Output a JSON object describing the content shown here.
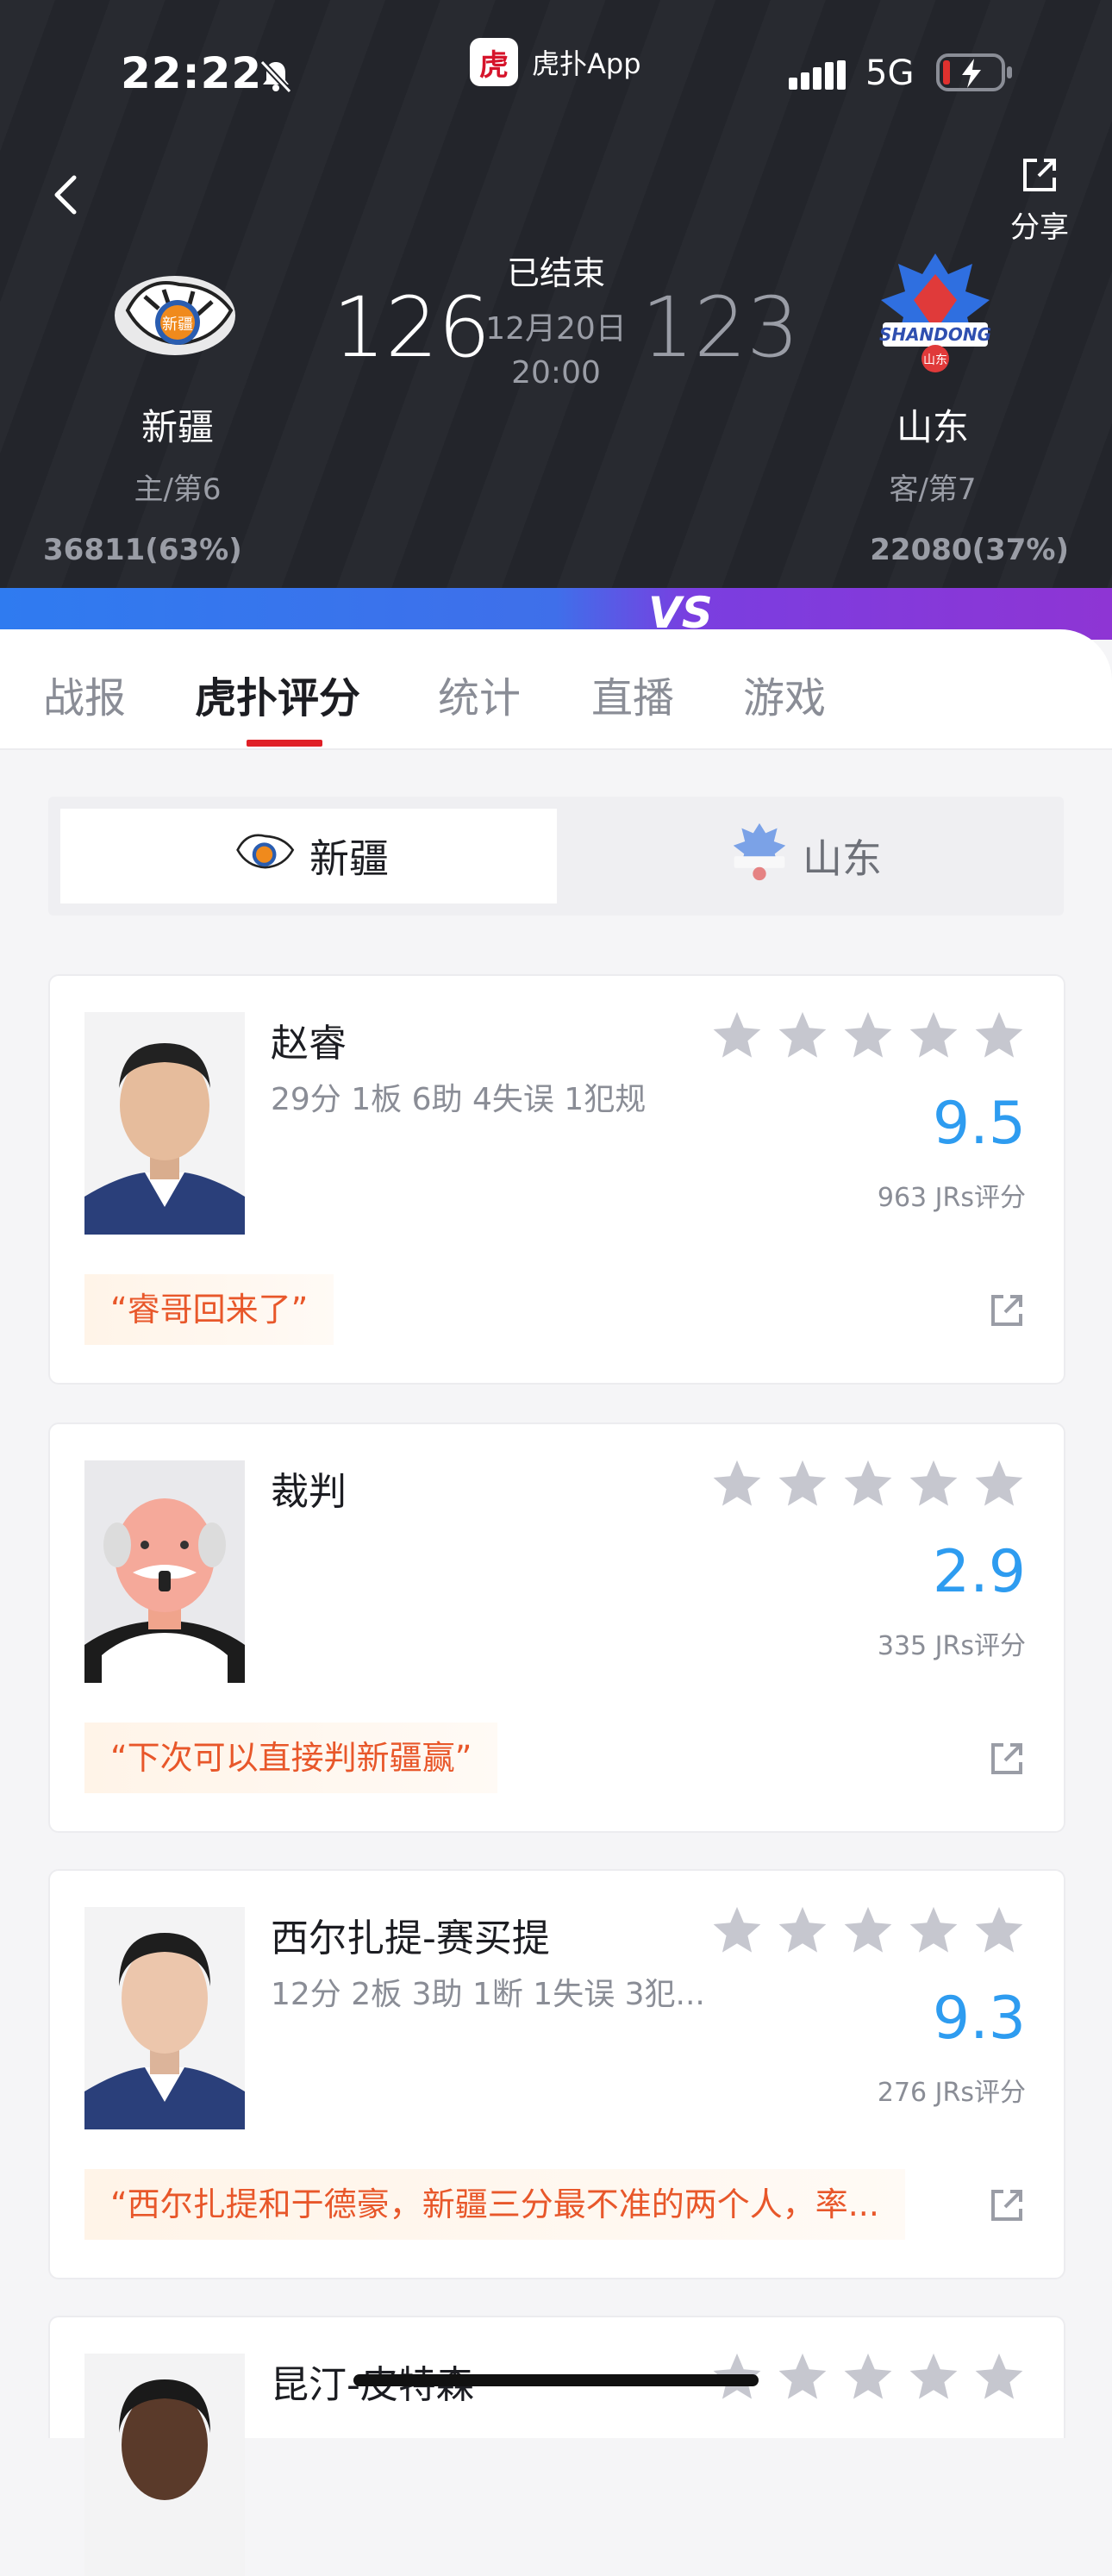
{
  "status_bar": {
    "time": "22:22",
    "app_icon_text": "虎",
    "app_name": "虎扑App",
    "network": "5G"
  },
  "header": {
    "share_label": "分享",
    "home": {
      "name": "新疆",
      "rank": "主/第6",
      "votes": "36811(63%)",
      "score": "126"
    },
    "away": {
      "name": "山东",
      "rank": "客/第7",
      "votes": "22080(37%)",
      "score": "123"
    },
    "status": "已结束",
    "date": "12月20日",
    "time": "20:00",
    "vs": "VS"
  },
  "tabs": [
    "战报",
    "虎扑评分",
    "统计",
    "直播",
    "游戏"
  ],
  "team_switch": {
    "left": "新疆",
    "right": "山东"
  },
  "cards": [
    {
      "name": "赵睿",
      "stats": "29分 1板 6助 4失误 1犯规",
      "score": "9.5",
      "votes": "963 JRs评分",
      "comment": "“睿哥回来了”"
    },
    {
      "name": "裁判",
      "stats": "",
      "score": "2.9",
      "votes": "335 JRs评分",
      "comment": "“下次可以直接判新疆赢”"
    },
    {
      "name": "西尔扎提-赛买提",
      "stats": "12分 2板 3助 1断 1失误 3犯...",
      "score": "9.3",
      "votes": "276 JRs评分",
      "comment": "“西尔扎提和于德豪，新疆三分最不准的两个人，率..."
    },
    {
      "name": "昆汀-皮特森"
    }
  ],
  "colors": {
    "header_bg": "#23252b",
    "score_blue": "#2e9cf0",
    "comment_orange": "#e8572a",
    "tab_red": "#e01f26"
  }
}
